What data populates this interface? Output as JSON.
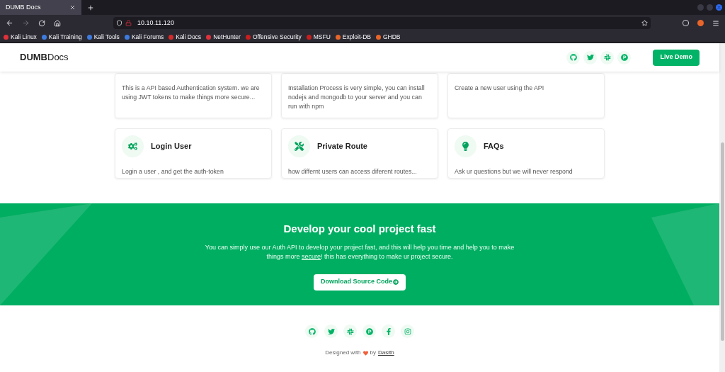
{
  "browser": {
    "tab_title": "DUMB Docs",
    "url": "10.10.11.120",
    "bookmarks": [
      {
        "label": "Kali Linux",
        "kind": "kali"
      },
      {
        "label": "Kali Training",
        "kind": "training"
      },
      {
        "label": "Kali Tools",
        "kind": "training"
      },
      {
        "label": "Kali Forums",
        "kind": "training"
      },
      {
        "label": "Kali Docs",
        "kind": "docs"
      },
      {
        "label": "NetHunter",
        "kind": "kali"
      },
      {
        "label": "Offensive Security",
        "kind": "offsec"
      },
      {
        "label": "MSFU",
        "kind": "offsec"
      },
      {
        "label": "Exploit-DB",
        "kind": "exploit"
      },
      {
        "label": "GHDB",
        "kind": "exploit"
      }
    ]
  },
  "header": {
    "logo_bold": "DUMB",
    "logo_light": "Docs",
    "button": "Live Demo"
  },
  "features": [
    {
      "description": "This is a API based Authentication system. we are using JWT tokens to make things more secure..."
    },
    {
      "description": "Installation Process is very simple, you can install nodejs and mongodb to your server and you can run with npm"
    },
    {
      "description": "Create a new user using the API"
    },
    {
      "title": "Login User",
      "description": "Login a user , and get the auth-token"
    },
    {
      "title": "Private Route",
      "description": "how differnt users can access diferent routes..."
    },
    {
      "title": "FAQs",
      "description": "Ask ur questions but we will never respond"
    }
  ],
  "cta": {
    "title": "Develop your cool project fast",
    "text_before": "You can simply use our Auth API to develop your project fast, and this will help you time and help you to make things more",
    "link": "secure",
    "text_after": "! this has everything to make ur project secure.",
    "button": "Download Source Code"
  },
  "footer": {
    "credit_before": "Designed with",
    "credit_by": "by",
    "author": "Dasith"
  }
}
